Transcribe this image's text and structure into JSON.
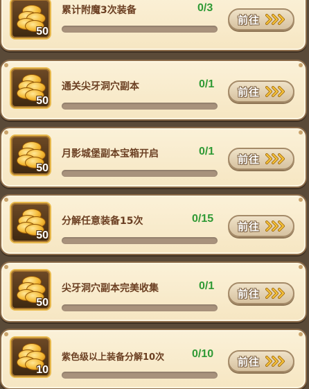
{
  "tasks": [
    {
      "title": "累计附魔3次装备",
      "progress": "0/3",
      "reward_qty": "50",
      "fill": 0,
      "button": "前往",
      "reward_icon": "gold-coins-icon"
    },
    {
      "title": "通关尖牙洞穴副本",
      "progress": "0/1",
      "reward_qty": "50",
      "fill": 0,
      "button": "前往",
      "reward_icon": "gold-coins-icon"
    },
    {
      "title": "月影城堡副本宝箱开启",
      "progress": "0/1",
      "reward_qty": "50",
      "fill": 0,
      "button": "前往",
      "reward_icon": "gold-coins-icon"
    },
    {
      "title": "分解任意装备15次",
      "progress": "0/15",
      "reward_qty": "50",
      "fill": 0,
      "button": "前往",
      "reward_icon": "gold-coins-icon"
    },
    {
      "title": "尖牙洞穴副本完美收集",
      "progress": "0/1",
      "reward_qty": "50",
      "fill": 0,
      "button": "前往",
      "reward_icon": "gold-coins-icon"
    },
    {
      "title": "紫色级以上装备分解10次",
      "progress": "0/10",
      "reward_qty": "10",
      "fill": 0,
      "button": "前往",
      "reward_icon": "gold-coins-icon"
    }
  ],
  "colors": {
    "progress_text": "#2f9a35",
    "title_text": "#6b3f22",
    "card_bg": "#fbf1d8",
    "button_bg": "#e4d4b6",
    "chevron": "#f2b328"
  }
}
